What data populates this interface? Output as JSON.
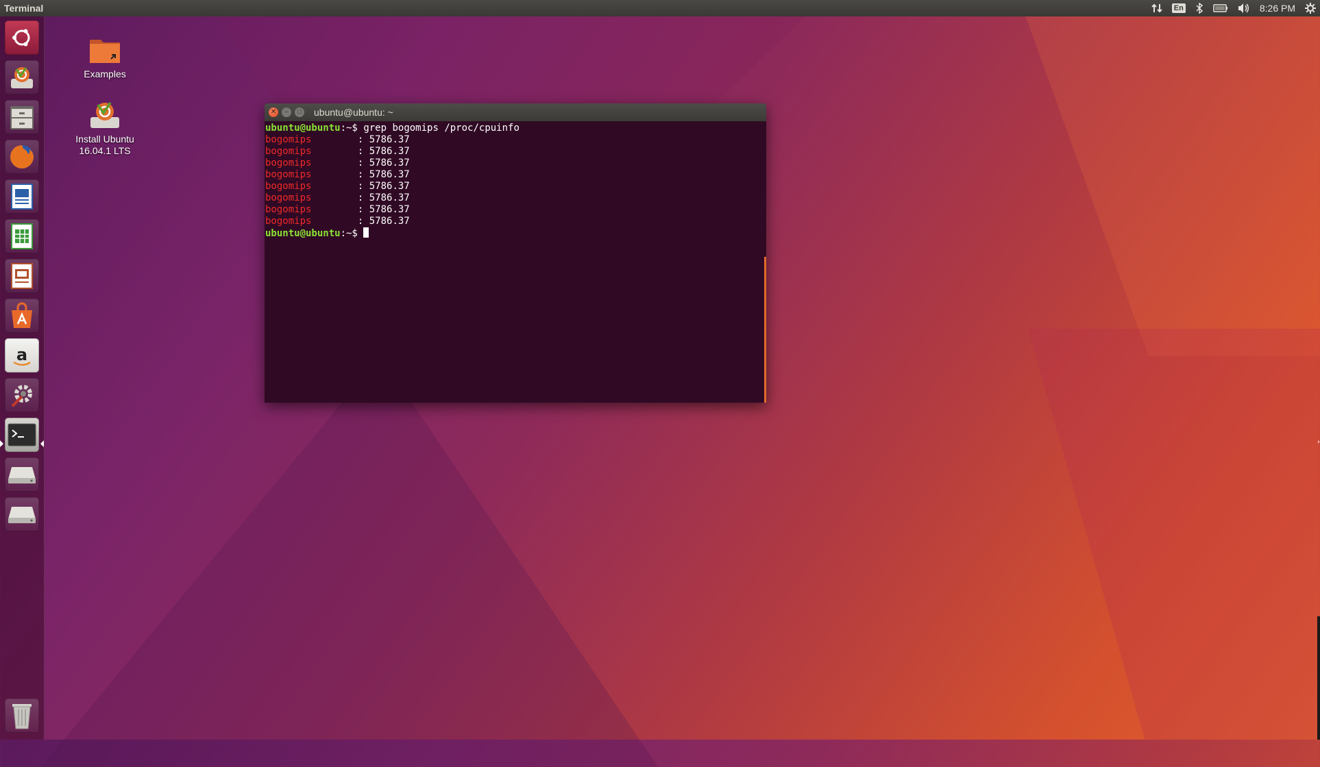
{
  "top_panel": {
    "app_title": "Terminal",
    "keyboard_layout": "En",
    "clock": "8:26 PM"
  },
  "launcher": {
    "items": [
      {
        "name": "dash-home",
        "icon": "ubuntu-logo-icon"
      },
      {
        "name": "install-ubuntu",
        "icon": "installer-icon"
      },
      {
        "name": "files",
        "icon": "file-cabinet-icon"
      },
      {
        "name": "firefox",
        "icon": "firefox-icon"
      },
      {
        "name": "writer",
        "icon": "libreoffice-writer-icon"
      },
      {
        "name": "calc",
        "icon": "libreoffice-calc-icon"
      },
      {
        "name": "impress",
        "icon": "libreoffice-impress-icon"
      },
      {
        "name": "software-center",
        "icon": "ubuntu-software-icon"
      },
      {
        "name": "amazon",
        "icon": "amazon-icon"
      },
      {
        "name": "system-settings",
        "icon": "system-settings-icon"
      },
      {
        "name": "terminal",
        "icon": "terminal-icon",
        "active": true
      },
      {
        "name": "drive-1",
        "icon": "drive-icon"
      },
      {
        "name": "drive-2",
        "icon": "drive-icon"
      },
      {
        "name": "trash",
        "icon": "trash-icon"
      }
    ]
  },
  "desktop": {
    "icons": [
      {
        "label": "Examples",
        "icon": "folder-icon"
      },
      {
        "label_line1": "Install Ubuntu",
        "label_line2": "16.04.1 LTS",
        "icon": "installer-icon"
      }
    ]
  },
  "terminal": {
    "title": "ubuntu@ubuntu: ~",
    "prompt_user": "ubuntu@ubuntu",
    "prompt_path": ":~$",
    "command": "grep bogomips /proc/cpuinfo",
    "output_lines": [
      {
        "key": "bogomips",
        "value": "        : 5786.37"
      },
      {
        "key": "bogomips",
        "value": "        : 5786.37"
      },
      {
        "key": "bogomips",
        "value": "        : 5786.37"
      },
      {
        "key": "bogomips",
        "value": "        : 5786.37"
      },
      {
        "key": "bogomips",
        "value": "        : 5786.37"
      },
      {
        "key": "bogomips",
        "value": "        : 5786.37"
      },
      {
        "key": "bogomips",
        "value": "        : 5786.37"
      },
      {
        "key": "bogomips",
        "value": "        : 5786.37"
      }
    ]
  },
  "colors": {
    "terminal_bg": "#300a24",
    "prompt_user": "#8ae234",
    "grep_match": "#ef2929",
    "close_button": "#df4a16"
  }
}
